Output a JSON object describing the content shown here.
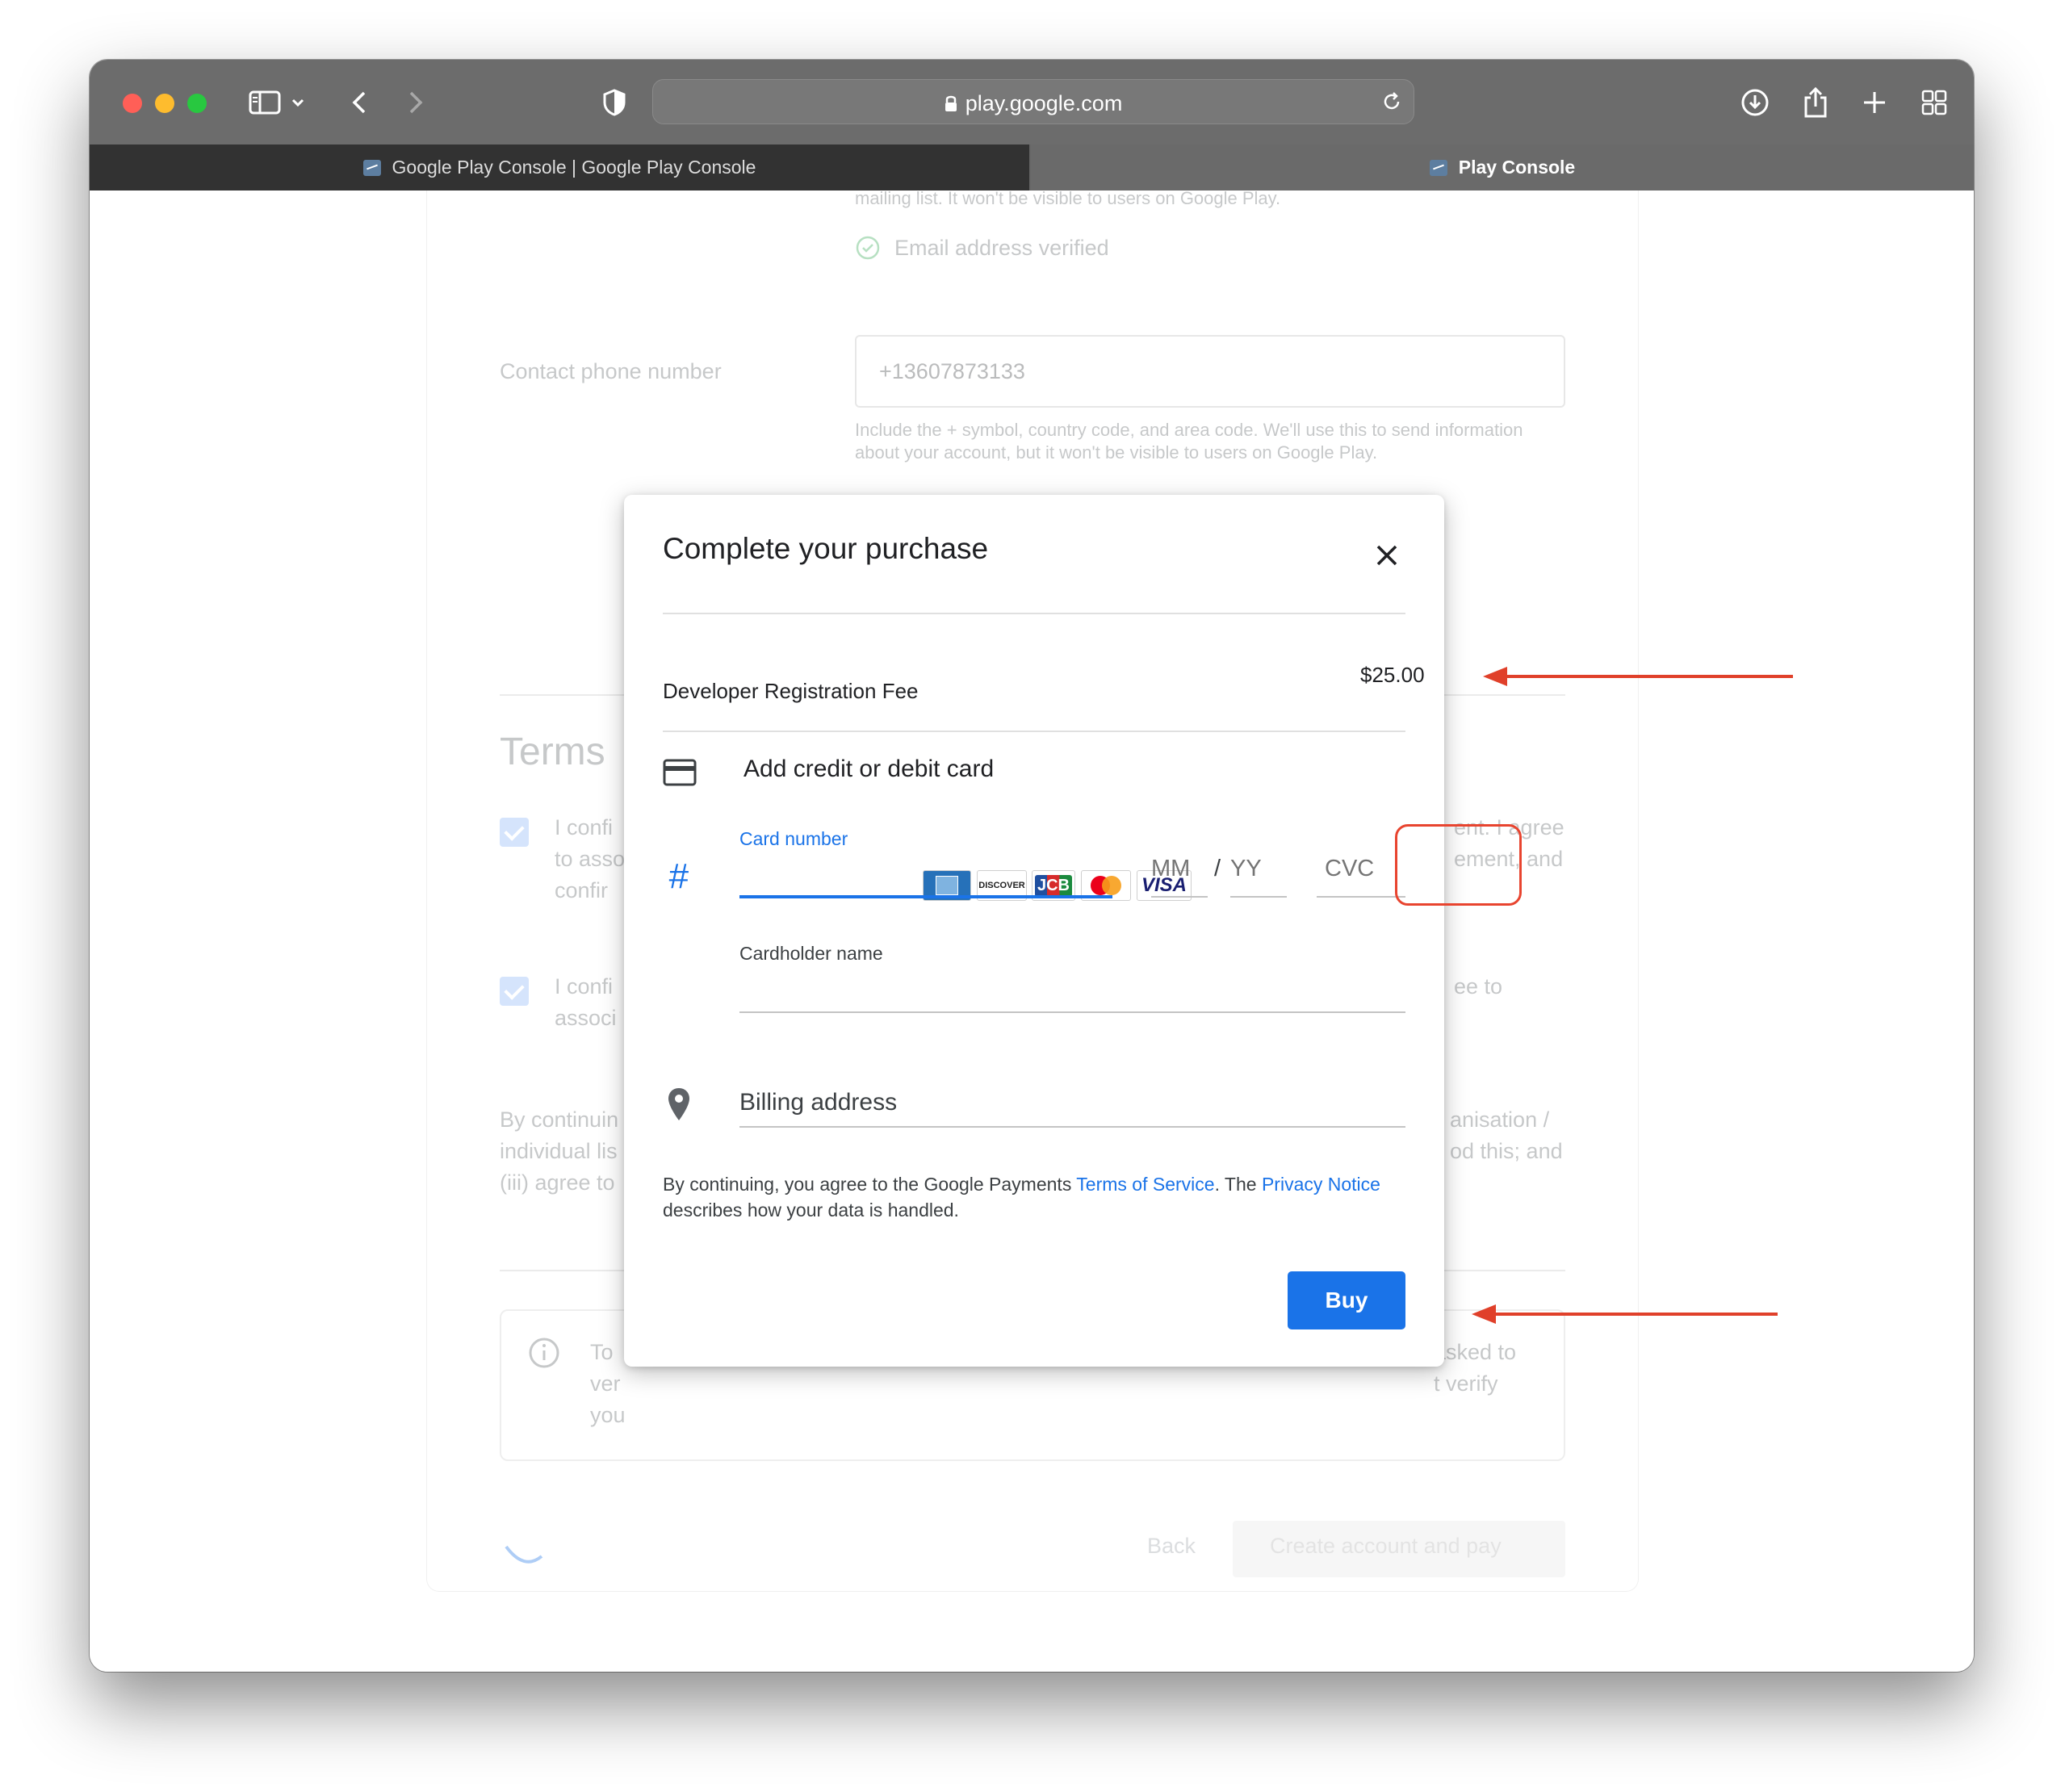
{
  "browser": {
    "url": "play.google.com",
    "tabs": [
      {
        "label": "Google Play Console | Google Play Console",
        "active": true
      },
      {
        "label": "Play Console",
        "active": false
      }
    ]
  },
  "background_page": {
    "email_hint": "mailing list. It won't be visible to users on Google Play.",
    "email_verified": "Email address verified",
    "phone_label": "Contact phone number",
    "phone_value": "+13607873133",
    "phone_help": "Include the + symbol, country code, and area code. We'll use this to send information about your account, but it won't be visible to users on Google Play.",
    "terms_heading": "Terms",
    "term1_left": [
      "I confi",
      "to asso",
      "confir"
    ],
    "term1_right": [
      "ent. I agree",
      "ement, and"
    ],
    "term2_left": [
      "I confi",
      "associ"
    ],
    "term2_right": "ee to",
    "continue_left": [
      "By continuin",
      "individual lis",
      "(iii) agree to"
    ],
    "continue_right": [
      "anisation /",
      "od this; and"
    ],
    "info_left": [
      "To",
      "ver",
      "you"
    ],
    "info_right": [
      "asked to",
      "t verify"
    ],
    "back_label": "Back",
    "create_label": "Create account and pay"
  },
  "modal": {
    "title": "Complete your purchase",
    "fee_label": "Developer Registration Fee",
    "fee_amount": "$25.00",
    "add_card_label": "Add credit or debit card",
    "card_number_label": "Card number",
    "card_brands": [
      "American Express",
      "Discover",
      "JCB",
      "MasterCard",
      "VISA"
    ],
    "visa_text": "VISA",
    "discover_text": "DISCOVER",
    "jcb_text": "JCB",
    "mm_placeholder": "MM",
    "slash": "/",
    "yy_placeholder": "YY",
    "cvc_placeholder": "CVC",
    "cardholder_label": "Cardholder name",
    "billing_label": "Billing address",
    "legal_prefix": "By continuing, you agree to the Google Payments ",
    "legal_tos": "Terms of Service",
    "legal_mid": ". The ",
    "legal_privacy": "Privacy Notice",
    "legal_suffix": " describes how your data is handled.",
    "buy_label": "Buy"
  },
  "colors": {
    "accent": "#1a73e8",
    "annotation": "#e0402a",
    "toolbar": "#6c6c6c"
  }
}
